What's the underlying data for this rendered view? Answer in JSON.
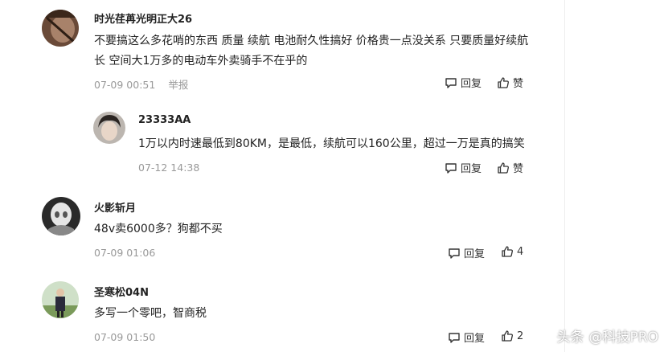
{
  "comments": [
    {
      "username": "时光荏苒光明正大26",
      "content": "不要搞这么多花哨的东西 质量 续航 电池耐久性搞好 价格贵一点没关系 只要质量好续航长 空间大1万多的电动车外卖骑手不在乎的",
      "time": "07-09 00:51",
      "report_label": "举报",
      "reply_label": "回复",
      "like_label": "赞"
    },
    {
      "username": "23333AA",
      "content": "1万以内时速最低到80KM，是最低，续航可以160公里，超过一万是真的搞笑",
      "time": "07-12 14:38",
      "reply_label": "回复",
      "like_label": "赞"
    },
    {
      "username": "火影斩月",
      "content": "48v卖6000多？狗都不买",
      "time": "07-09 01:06",
      "reply_label": "回复",
      "like_label": "4"
    },
    {
      "username": "圣寒松04N",
      "content": "多写一个零吧，智商税",
      "time": "07-09 01:50",
      "reply_label": "回复",
      "like_label": "2"
    }
  ],
  "watermark": {
    "brand": "头条",
    "account": "@科技PRO"
  },
  "colors": {
    "text": "#222222",
    "meta": "#999999"
  }
}
